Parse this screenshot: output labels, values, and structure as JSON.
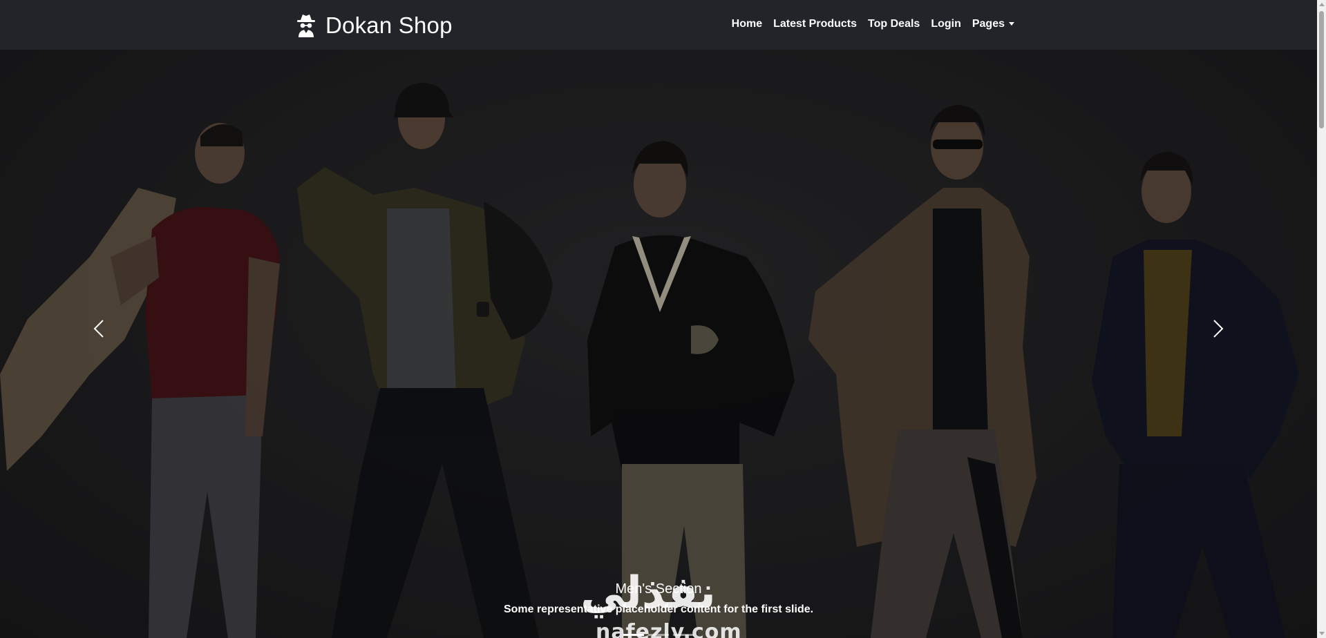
{
  "navbar": {
    "brand_text": "Dokan Shop",
    "brand_icon": "incognito-spy-icon",
    "links": [
      {
        "label": "Home"
      },
      {
        "label": "Latest Products"
      },
      {
        "label": "Top Deals"
      },
      {
        "label": "Login"
      },
      {
        "label": "Pages",
        "dropdown": true
      }
    ]
  },
  "carousel": {
    "slide_image": "five-male-models-photo",
    "caption_title": "Men's Section",
    "caption_text": "Some representative placeholder content for the first slide.",
    "prev_icon": "chevron-left-icon",
    "next_icon": "chevron-right-icon",
    "indicator_count": 3,
    "active_indicator": 1
  },
  "watermark": {
    "arabic": "نفذلي",
    "latin": "nafezly.com"
  },
  "colors": {
    "navbar_bg": "#212529",
    "hero_bg": "#1f1f21",
    "text": "#ffffff"
  }
}
